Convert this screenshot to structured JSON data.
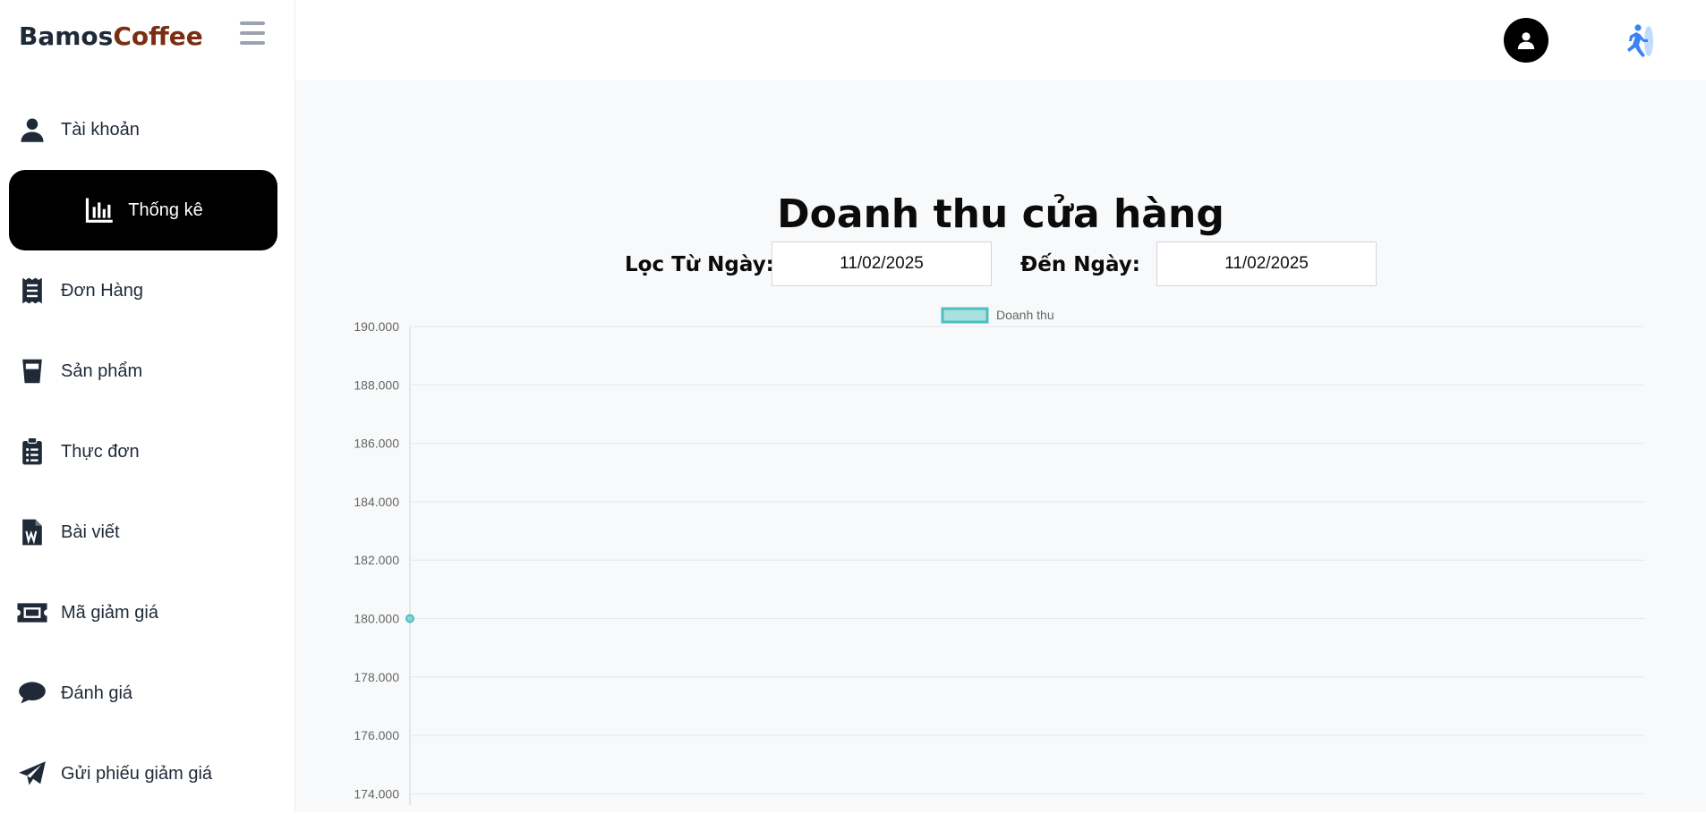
{
  "brand": {
    "part1": "Bamos",
    "part2": "Coffee"
  },
  "sidebar": {
    "items": [
      {
        "label": "Tài khoản",
        "icon": "user-icon"
      },
      {
        "label": "Thống kê",
        "icon": "chart-bar-icon",
        "active": true
      },
      {
        "label": "Đơn Hàng",
        "icon": "receipt-icon"
      },
      {
        "label": "Sản phẩm",
        "icon": "cup-icon"
      },
      {
        "label": "Thực đơn",
        "icon": "clipboard-list-icon"
      },
      {
        "label": "Bài viết",
        "icon": "word-file-icon"
      },
      {
        "label": "Mã giảm giá",
        "icon": "ticket-icon"
      },
      {
        "label": "Đánh giá",
        "icon": "comment-icon"
      },
      {
        "label": "Gửi phiếu giảm giá",
        "icon": "paper-plane-icon"
      }
    ]
  },
  "header": {
    "avatar_icon": "user-avatar-icon",
    "logout_icon": "running-exit-icon"
  },
  "main": {
    "title": "Doanh thu cửa hàng",
    "filter": {
      "from_label": "Lọc Từ Ngày:",
      "from_value": "11/02/2025",
      "to_label": "Đến Ngày:",
      "to_value": "11/02/2025"
    }
  },
  "colors": {
    "accent": "#4bc0c0",
    "active_bg": "#000000",
    "brand_dark": "#1f2937",
    "brand_coffee": "#7a2e12"
  },
  "chart_data": {
    "type": "line",
    "series": [
      {
        "name": "Doanh thu",
        "values": [
          180000
        ]
      }
    ],
    "x": [
      ""
    ],
    "ylim": [
      174000,
      190000
    ],
    "yticks": [
      "190.000",
      "188.000",
      "186.000",
      "184.000",
      "182.000",
      "180.000",
      "178.000",
      "176.000",
      "174.000"
    ],
    "grid": true,
    "legend": "top"
  }
}
